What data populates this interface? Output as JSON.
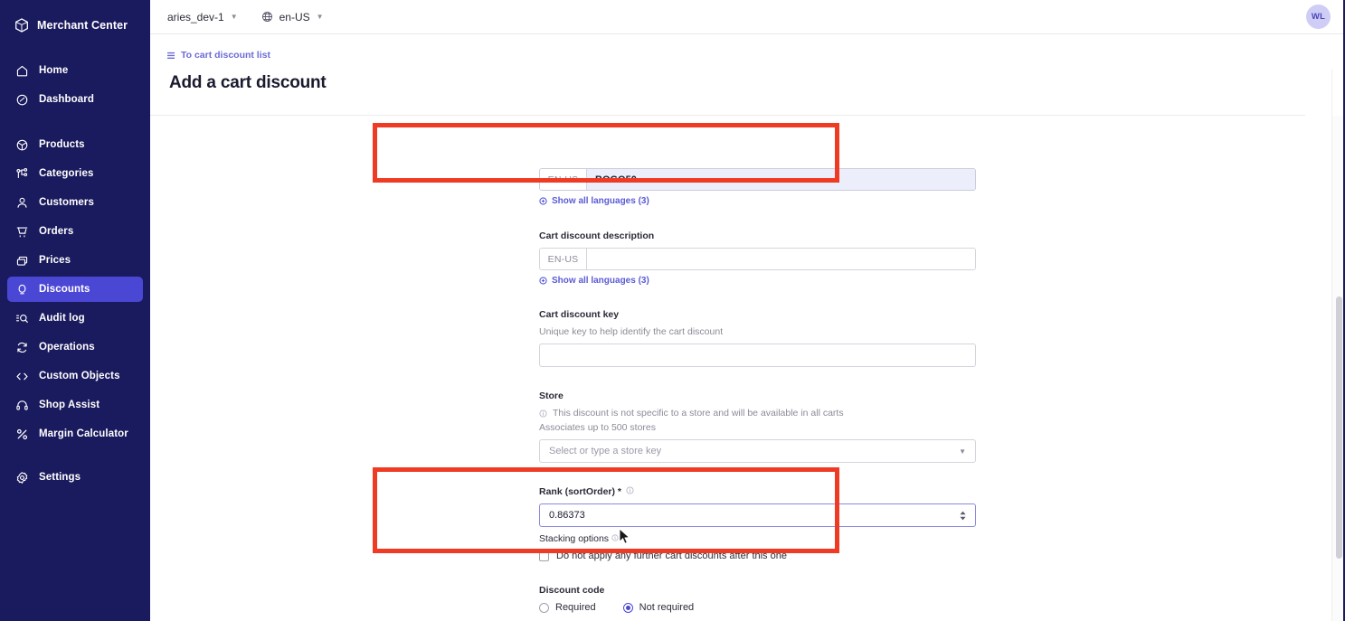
{
  "brand": {
    "name": "Merchant Center",
    "logo_icon": "cube-logo-icon"
  },
  "sidebar": {
    "items": [
      {
        "label": "Home",
        "icon": "home-icon",
        "active": false
      },
      {
        "label": "Dashboard",
        "icon": "dashboard-icon",
        "active": false
      },
      {
        "label": "Products",
        "icon": "products-icon",
        "active": false
      },
      {
        "label": "Categories",
        "icon": "categories-icon",
        "active": false
      },
      {
        "label": "Customers",
        "icon": "customers-icon",
        "active": false
      },
      {
        "label": "Orders",
        "icon": "orders-icon",
        "active": false
      },
      {
        "label": "Prices",
        "icon": "prices-icon",
        "active": false
      },
      {
        "label": "Discounts",
        "icon": "discounts-icon",
        "active": true
      },
      {
        "label": "Audit log",
        "icon": "audit-log-icon",
        "active": false
      },
      {
        "label": "Operations",
        "icon": "operations-icon",
        "active": false
      },
      {
        "label": "Custom Objects",
        "icon": "custom-objects-icon",
        "active": false
      },
      {
        "label": "Shop Assist",
        "icon": "shop-assist-icon",
        "active": false
      },
      {
        "label": "Margin Calculator",
        "icon": "margin-calculator-icon",
        "active": false
      },
      {
        "label": "Settings",
        "icon": "settings-icon",
        "active": false
      }
    ],
    "active_color": "#4a47d5",
    "background_color": "#1a1a5e"
  },
  "topbar": {
    "project": "aries_dev-1",
    "locale": "en-US",
    "locale_icon": "globe-icon",
    "avatar_initials": "WL"
  },
  "breadcrumb": {
    "label": "To cart discount list",
    "icon": "back-list-icon"
  },
  "page": {
    "title": "Add a cart discount"
  },
  "form": {
    "name": {
      "locale": "EN-US",
      "value": "BOGO50",
      "show_languages": "Show all languages (3)",
      "show_languages_icon": "expand-circle-icon"
    },
    "description": {
      "label": "Cart discount description",
      "locale": "EN-US",
      "value": "",
      "show_languages": "Show all languages (3)",
      "show_languages_icon": "expand-circle-icon"
    },
    "key": {
      "label": "Cart discount key",
      "hint": "Unique key to help identify the cart discount",
      "value": ""
    },
    "store": {
      "label": "Store",
      "note": "This discount is not specific to a store and will be available in all carts",
      "note_icon": "info-circle-icon",
      "associates": "Associates up to 500 stores",
      "placeholder": "Select or type a store key",
      "caret_icon": "chevron-down-icon"
    },
    "rank": {
      "label": "Rank (sortOrder) *",
      "info_icon": "info-circle-icon",
      "value": "0.86373",
      "spinner_icon": "stepper-icon"
    },
    "stacking": {
      "label": "Stacking options",
      "info_icon": "info-circle-icon",
      "checkbox_label": "Do not apply any further cart discounts after this one",
      "checked": false
    },
    "discount_code": {
      "label": "Discount code",
      "options": [
        {
          "label": "Required",
          "selected": false
        },
        {
          "label": "Not required",
          "selected": true
        }
      ]
    }
  },
  "annotations": {
    "color": "#ef3b24",
    "boxes": [
      {
        "name": "name-field-highlight"
      },
      {
        "name": "rank-stacking-highlight"
      }
    ]
  }
}
